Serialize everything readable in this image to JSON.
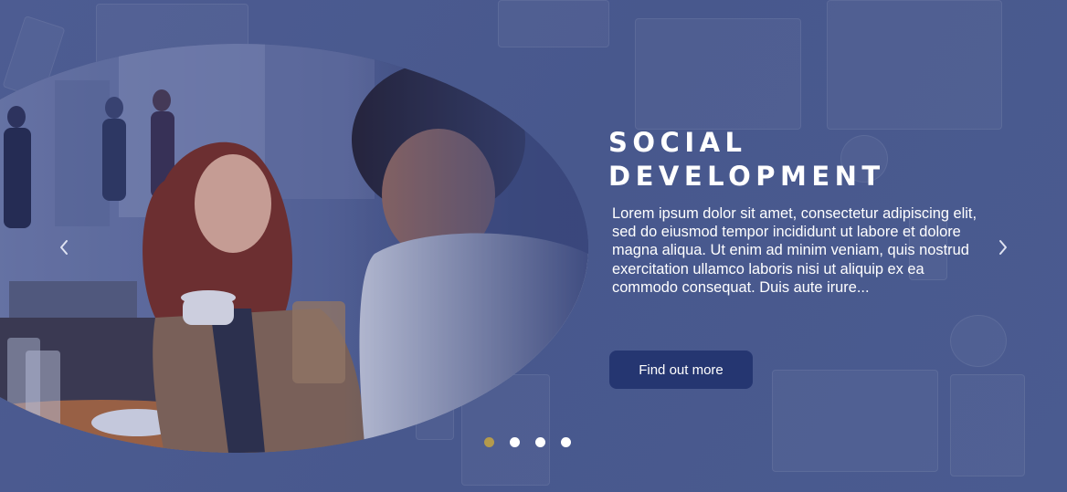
{
  "slide": {
    "title_line1": "SOCIAL",
    "title_line2": "DEVELOPMENT",
    "description": "Lorem ipsum dolor sit amet, consectetur adipiscing elit, sed do eiusmod tempor incididunt ut labore et dolore magna aliqua. Ut enim ad minim veniam, quis nostrud exercitation ullamco laboris nisi ut aliquip ex ea commodo consequat. Duis aute irure...",
    "cta_label": "Find out more"
  },
  "carousel": {
    "total_slides": 4,
    "active_index": 0,
    "prev_icon": "chevron-left-icon",
    "next_icon": "chevron-right-icon"
  },
  "colors": {
    "overlay": "#4a5a8e",
    "button": "#253671",
    "active_dot": "#b49a4c",
    "dot": "#ffffff"
  }
}
